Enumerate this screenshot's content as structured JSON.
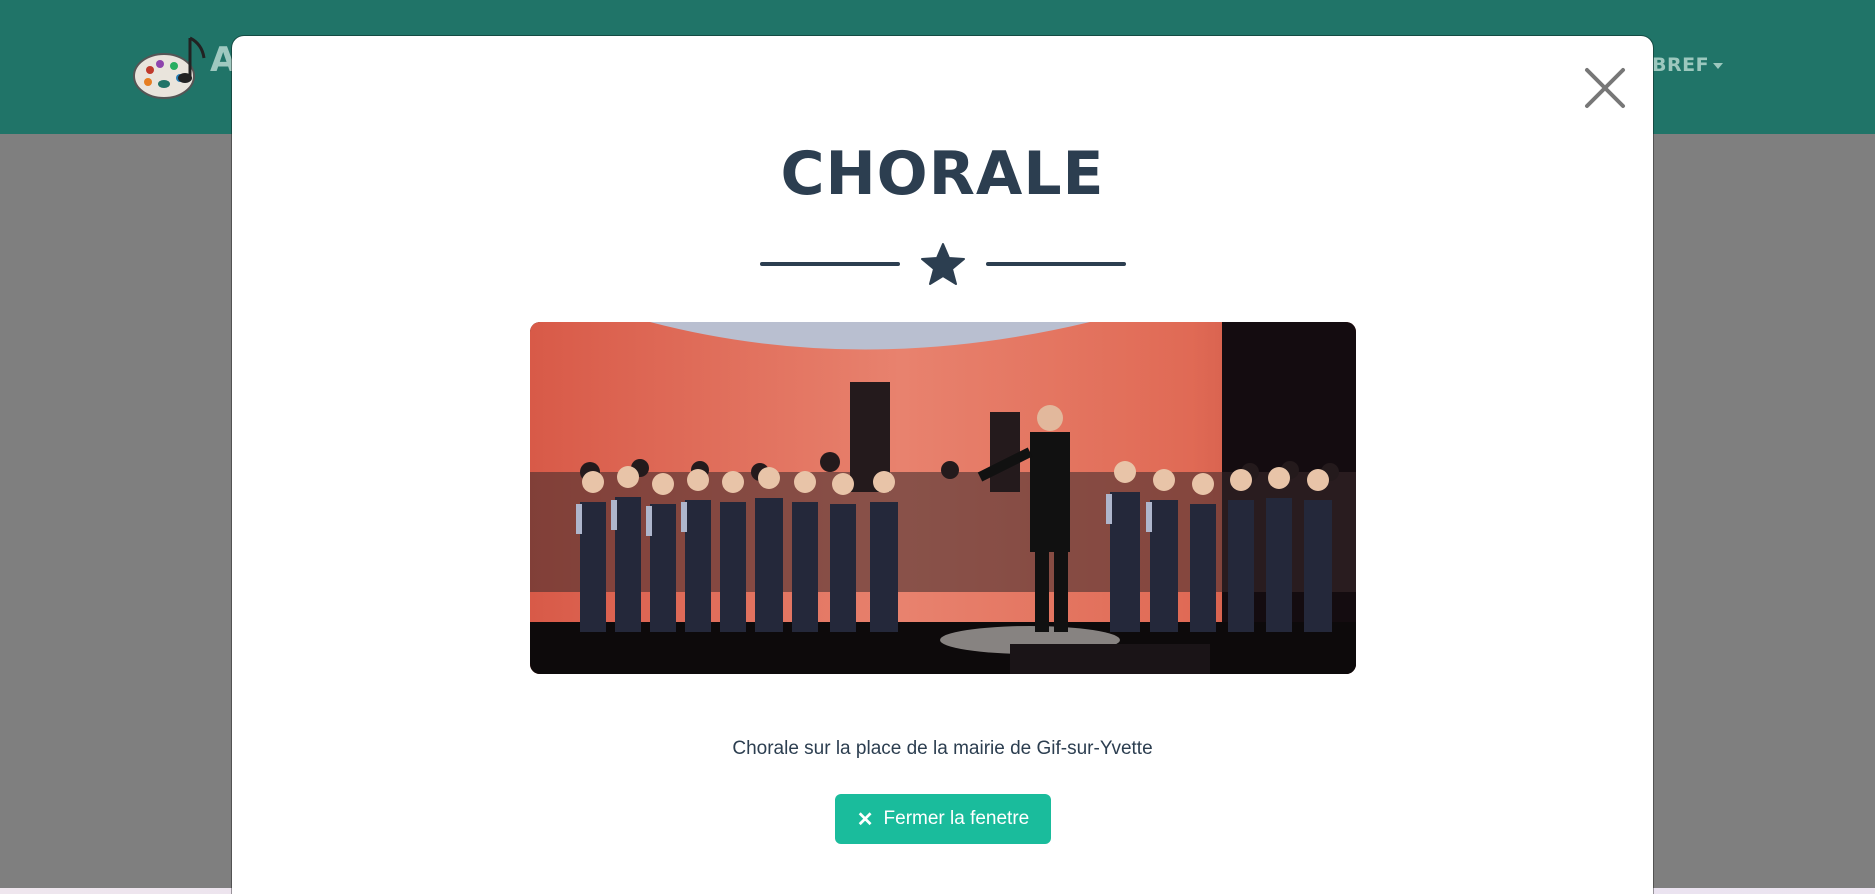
{
  "navbar": {
    "brand_partial": "A",
    "menu_partial": "BREF"
  },
  "modal": {
    "title": "CHORALE",
    "caption": "Chorale sur la place de la mairie de Gif-sur-Yvette",
    "close_button_label": "Fermer la fenetre",
    "close_button_icon": "times-icon",
    "close_icon": "close-x-icon",
    "divider_icon": "star-icon",
    "photo_subject": "choir-photo"
  },
  "colors": {
    "navbar": "#207468",
    "title": "#2c3e50",
    "button": "#1abc9c",
    "overlay": "#808080"
  }
}
